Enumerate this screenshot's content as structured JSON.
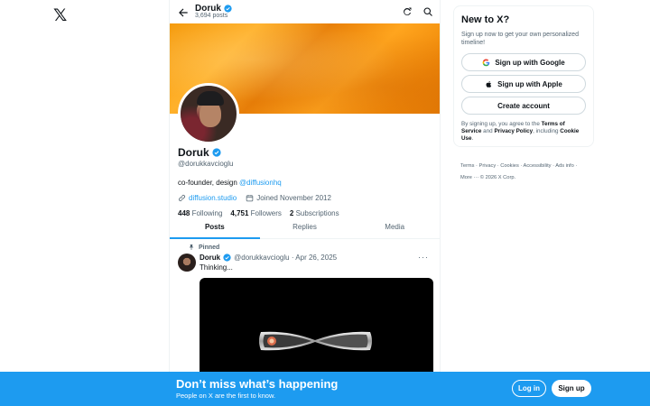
{
  "logo": "𝕏",
  "header": {
    "name": "Doruk",
    "posts_count": "3,694 posts"
  },
  "profile": {
    "name": "Doruk",
    "handle": "@dorukkavcioglu",
    "bio_text": "co-founder, design ",
    "bio_link": "@diffusionhq",
    "website": "diffusion.studio",
    "joined": "Joined November 2012",
    "following_count": "448",
    "following_label": "Following",
    "followers_count": "4,751",
    "followers_label": "Followers",
    "subscriptions_count": "2",
    "subscriptions_label": "Subscriptions"
  },
  "tabs": [
    {
      "label": "Posts"
    },
    {
      "label": "Replies"
    },
    {
      "label": "Media"
    }
  ],
  "post": {
    "pinned_label": "Pinned",
    "author": "Doruk",
    "handle_date": "@dorukkavcioglu · Apr 26, 2025",
    "text": "Thinking...",
    "more": "···"
  },
  "sidebar": {
    "title": "New to X?",
    "subtitle": "Sign up now to get your own personalized timeline!",
    "google_button": "Sign up with Google",
    "apple_button": "Sign up with Apple",
    "create_button": "Create account",
    "legal_pre": "By signing up, you agree to the ",
    "terms": "Terms of Service",
    "legal_and": " and ",
    "privacy": "Privacy Policy",
    "legal_incl": ", including ",
    "cookie": "Cookie Use",
    "legal_end": "."
  },
  "footer": {
    "line1": "Terms · Privacy · Cookies · Accessibility · Ads info ·",
    "line2": "More ··· © 2026 X Corp."
  },
  "bottom_banner": {
    "title": "Don’t miss what’s happening",
    "subtitle": "People on X are the first to know.",
    "login": "Log in",
    "signup": "Sign up"
  },
  "colors": {
    "accent": "#1d9bf0",
    "text": "#0f1419",
    "secondary": "#536471"
  }
}
